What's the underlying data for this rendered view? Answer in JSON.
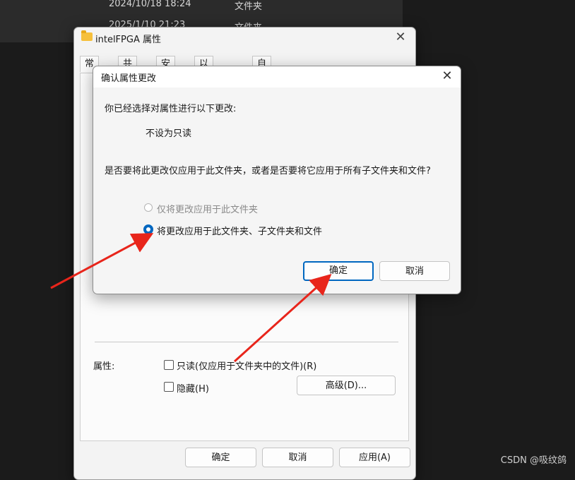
{
  "background": {
    "rows": [
      {
        "date": "2024/10/18 18:24",
        "type": "文件夹"
      },
      {
        "date": "2025/1/10 21:23",
        "type": "文件夹"
      }
    ]
  },
  "properties_window": {
    "title": "intelFPGA 属性",
    "tabs": [
      "常规",
      "共享",
      "安全",
      "以前的版本",
      "自定义"
    ],
    "attributes_label": "属性:",
    "readonly_label": "只读(仅应用于文件夹中的文件)(R)",
    "hidden_label": "隐藏(H)",
    "advanced_button": "高级(D)...",
    "ok_button": "确定",
    "cancel_button": "取消",
    "apply_button": "应用(A)"
  },
  "confirm_dialog": {
    "title": "确认属性更改",
    "intro": "你已经选择对属性进行以下更改:",
    "change": "不设为只读",
    "question": "是否要将此更改仅应用于此文件夹，或者是否要将它应用于所有子文件夹和文件?",
    "option_folder_only": "仅将更改应用于此文件夹",
    "option_all": "将更改应用于此文件夹、子文件夹和文件",
    "selected_option": "option_all",
    "ok_button": "确定",
    "cancel_button": "取消"
  },
  "watermark": "CSDN @吸纹鸽",
  "colors": {
    "accent": "#0067c0",
    "arrow": "#e8251b"
  }
}
